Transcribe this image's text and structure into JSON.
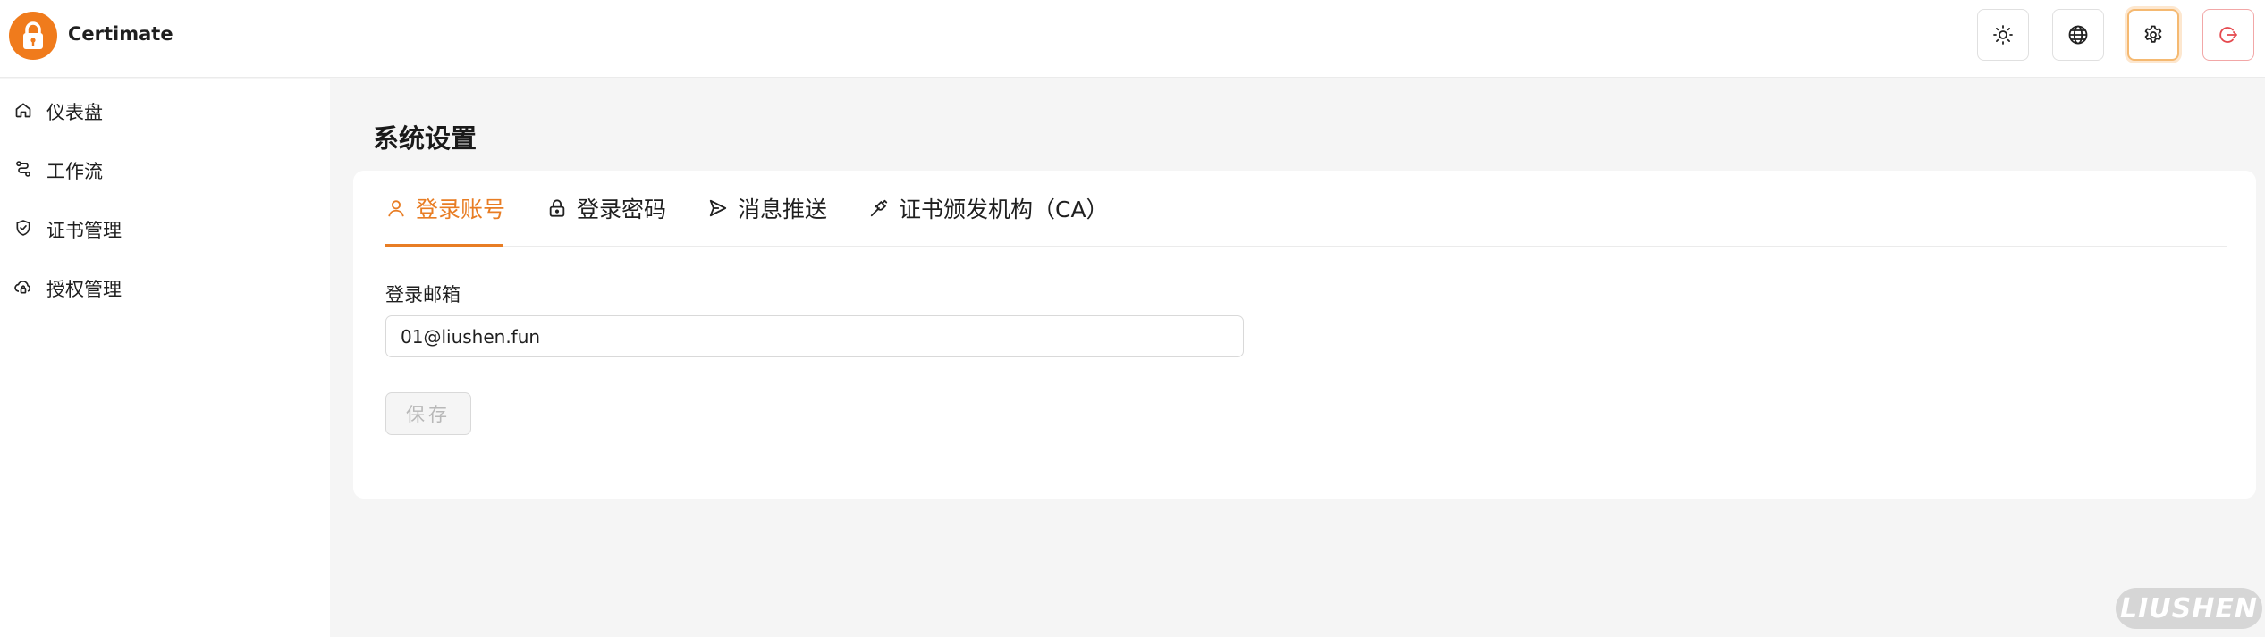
{
  "app": {
    "name": "Certimate",
    "accent_color": "#f07b1c"
  },
  "header": {
    "buttons": [
      {
        "name": "theme",
        "icon": "sun-icon"
      },
      {
        "name": "language",
        "icon": "globe-icon"
      },
      {
        "name": "settings",
        "icon": "gear-icon",
        "active": true
      },
      {
        "name": "logout",
        "icon": "logout-icon"
      }
    ]
  },
  "sidebar": {
    "items": [
      {
        "label": "仪表盘",
        "icon": "home-icon"
      },
      {
        "label": "工作流",
        "icon": "workflow-icon"
      },
      {
        "label": "证书管理",
        "icon": "shield-check-icon"
      },
      {
        "label": "授权管理",
        "icon": "cloud-lock-icon"
      }
    ]
  },
  "main": {
    "title": "系统设置",
    "tabs": [
      {
        "label": "登录账号",
        "icon": "user-icon",
        "active": true
      },
      {
        "label": "登录密码",
        "icon": "lock-icon"
      },
      {
        "label": "消息推送",
        "icon": "send-icon"
      },
      {
        "label": "证书颁发机构（CA）",
        "icon": "plug-icon"
      }
    ],
    "form": {
      "email_label": "登录邮箱",
      "email_value": "01@liushen.fun",
      "save_label": "保存"
    }
  },
  "watermark": {
    "text": "LIUSHEN"
  }
}
